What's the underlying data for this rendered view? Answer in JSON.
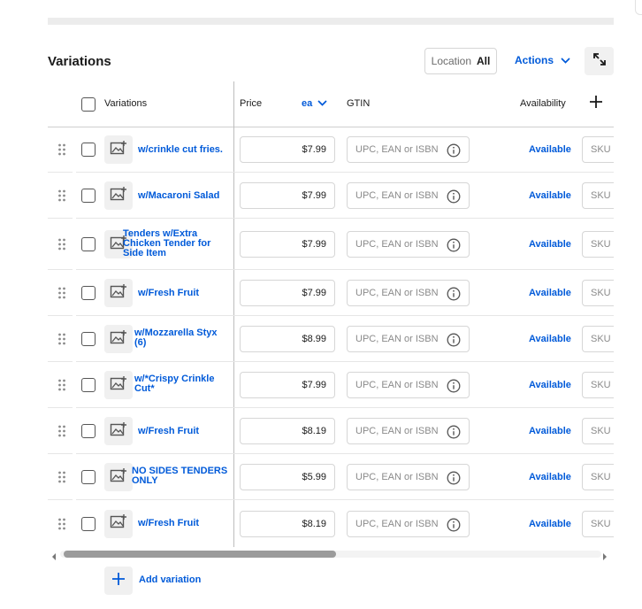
{
  "section_title": "Variations",
  "location": {
    "label": "Location",
    "value": "All"
  },
  "actions_label": "Actions",
  "table": {
    "headers": {
      "variations": "Variations",
      "price": "Price",
      "unit": "ea",
      "gtin": "GTIN",
      "availability": "Availability"
    },
    "rows": [
      {
        "name": "w/crinkle cut fries.",
        "price": "$7.99",
        "gtin_placeholder": "UPC, EAN or ISBN",
        "availability": "Available",
        "sku_placeholder": "SKU"
      },
      {
        "name": "w/Macaroni Salad",
        "price": "$7.99",
        "gtin_placeholder": "UPC, EAN or ISBN",
        "availability": "Available",
        "sku_placeholder": "SKU"
      },
      {
        "name": "Tenders w/Extra Chicken Tender for Side Item",
        "price": "$7.99",
        "gtin_placeholder": "UPC, EAN or ISBN",
        "availability": "Available",
        "sku_placeholder": "SKU"
      },
      {
        "name": "w/Fresh Fruit",
        "price": "$7.99",
        "gtin_placeholder": "UPC, EAN or ISBN",
        "availability": "Available",
        "sku_placeholder": "SKU"
      },
      {
        "name": "w/Mozzarella Styx (6)",
        "price": "$8.99",
        "gtin_placeholder": "UPC, EAN or ISBN",
        "availability": "Available",
        "sku_placeholder": "SKU"
      },
      {
        "name": "w/*Crispy Crinkle Cut*",
        "price": "$7.99",
        "gtin_placeholder": "UPC, EAN or ISBN",
        "availability": "Available",
        "sku_placeholder": "SKU"
      },
      {
        "name": "w/Fresh Fruit",
        "price": "$8.19",
        "gtin_placeholder": "UPC, EAN or ISBN",
        "availability": "Available",
        "sku_placeholder": "SKU"
      },
      {
        "name": "NO SIDES TENDERS ONLY",
        "price": "$5.99",
        "gtin_placeholder": "UPC, EAN or ISBN",
        "availability": "Available",
        "sku_placeholder": "SKU"
      },
      {
        "name": "w/Fresh Fruit",
        "price": "$8.19",
        "gtin_placeholder": "UPC, EAN or ISBN",
        "availability": "Available",
        "sku_placeholder": "SKU"
      }
    ]
  },
  "add_variation_label": "Add variation",
  "icons": {
    "expand": "expand-icon",
    "actions_chevron": "chevron-down-icon",
    "add_column": "plus-icon",
    "drag": "drag-handle-icon",
    "image": "add-image-icon",
    "info": "info-icon",
    "add": "plus-icon"
  },
  "colors": {
    "link": "#005ad9",
    "text": "#1a1a1a",
    "border": "#d6d6d6",
    "placeholder": "#8a8a8a"
  }
}
